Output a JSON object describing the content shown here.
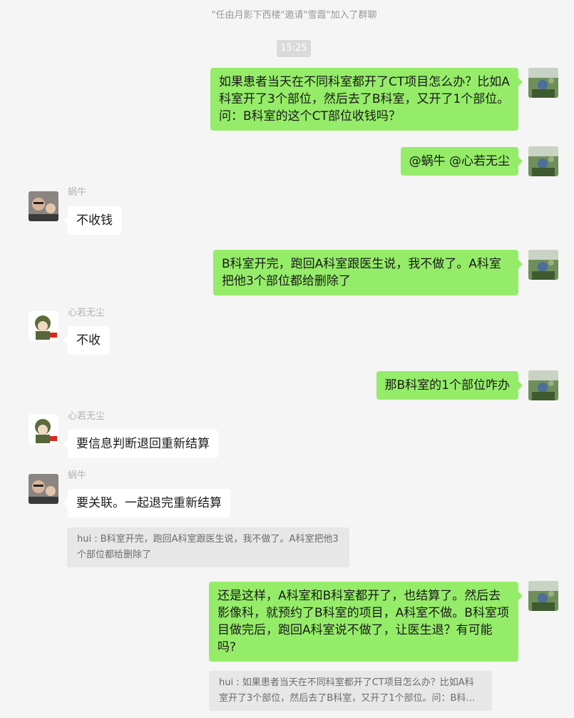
{
  "system_notice": "\"任由月影下西楼\"邀请\"雪霞\"加入了群聊",
  "timestamp": "15:25",
  "messages": [
    {
      "sender": "me",
      "text": "如果患者当天在不同科室都开了CT项目怎么办？比如A科室开了3个部位，然后去了B科室，又开了1个部位。问：B科室的这个CT部位收钱吗？"
    },
    {
      "sender": "me",
      "text": "@蜗牛 @心若无尘"
    },
    {
      "sender": "蜗牛",
      "text": "不收钱"
    },
    {
      "sender": "me",
      "text": "B科室开完，跑回A科室跟医生说，我不做了。A科室把他3个部位都给删除了"
    },
    {
      "sender": "心若无尘",
      "text": "不收"
    },
    {
      "sender": "me",
      "text": "那B科室的1个部位咋办"
    },
    {
      "sender": "心若无尘",
      "text": "要信息判断退回重新结算"
    },
    {
      "sender": "蜗牛",
      "text": "要关联。一起退完重新结算",
      "quote": "hui : B科室开完，跑回A科室跟医生说，我不做了。A科室把他3个部位都给删除了"
    },
    {
      "sender": "me",
      "text": "还是这样，A科室和B科室都开了，也结算了。然后去影像科，就预约了B科室的项目，A科室不做。B科室项目做完后，跑回A科室说不做了，让医生退？有可能吗?",
      "quote": "hui : 如果患者当天在不同科室都开了CT项目怎么办？比如A科室开了3个部位，然后去了B科室，又开了1个部位。问：B科室的这个CT部位收钱吗？"
    }
  ],
  "colors": {
    "my_bubble": "#95ec69",
    "other_bubble": "#ffffff",
    "background": "#f5f5f5"
  },
  "avatars": {
    "me": "landscape-photo-avatar",
    "蜗牛": "selfie-photo-avatar",
    "心若无尘": "soldier-cartoon-avatar"
  }
}
